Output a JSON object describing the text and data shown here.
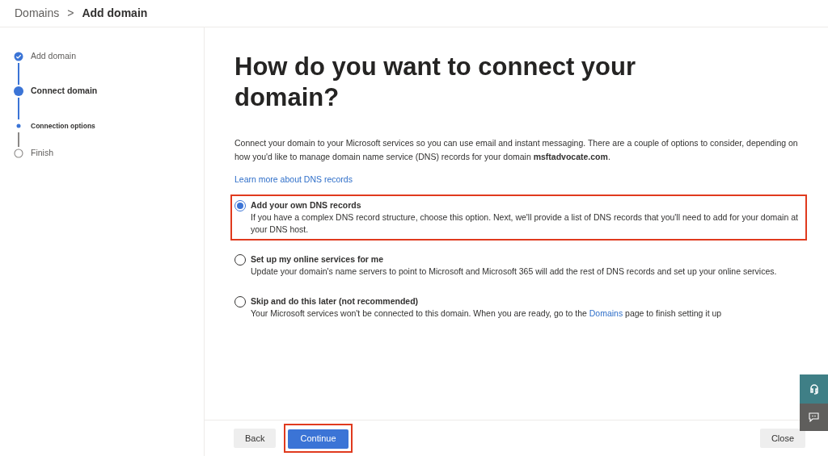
{
  "breadcrumb": {
    "parent": "Domains",
    "separator": ">",
    "current": "Add domain"
  },
  "steps": [
    {
      "label": "Add domain",
      "kind": "done"
    },
    {
      "label": "Connect domain",
      "kind": "current"
    },
    {
      "label": "Connection options",
      "kind": "substep"
    },
    {
      "label": "Finish",
      "kind": "pending"
    }
  ],
  "heading": "How do you want to connect your domain?",
  "intro": "Connect your domain to your Microsoft services so you can use email and instant messaging. There are a couple of options to consider, depending on how you'd like to manage domain name service (DNS) records for your domain **msftadvocate.com**.",
  "learn_link": "Learn more about DNS records",
  "options": [
    {
      "title": "Add your own DNS records",
      "description": [
        {
          "text": "If you have a complex DNS record structure, choose this option. Next, we'll provide a list of DNS records that you'll need to add for your domain at your DNS host."
        }
      ],
      "selected": true,
      "highlighted": true
    },
    {
      "title": "Set up my online services for me",
      "description": [
        {
          "text": "Update your domain's name servers to point to Microsoft and Microsoft 365 will add the rest of DNS records and set up your online services."
        }
      ],
      "selected": false,
      "highlighted": false
    },
    {
      "title": "Skip and do this later (not recommended)",
      "description": [
        {
          "text": "Your Microsoft services won't be connected to this domain. When you are ready, go to the "
        },
        {
          "text": "Domains",
          "link": true
        },
        {
          "text": " page to finish setting it up"
        }
      ],
      "selected": false,
      "highlighted": false
    }
  ],
  "footer": {
    "back": "Back",
    "continue": "Continue",
    "continue_highlighted": true,
    "close": "Close"
  }
}
